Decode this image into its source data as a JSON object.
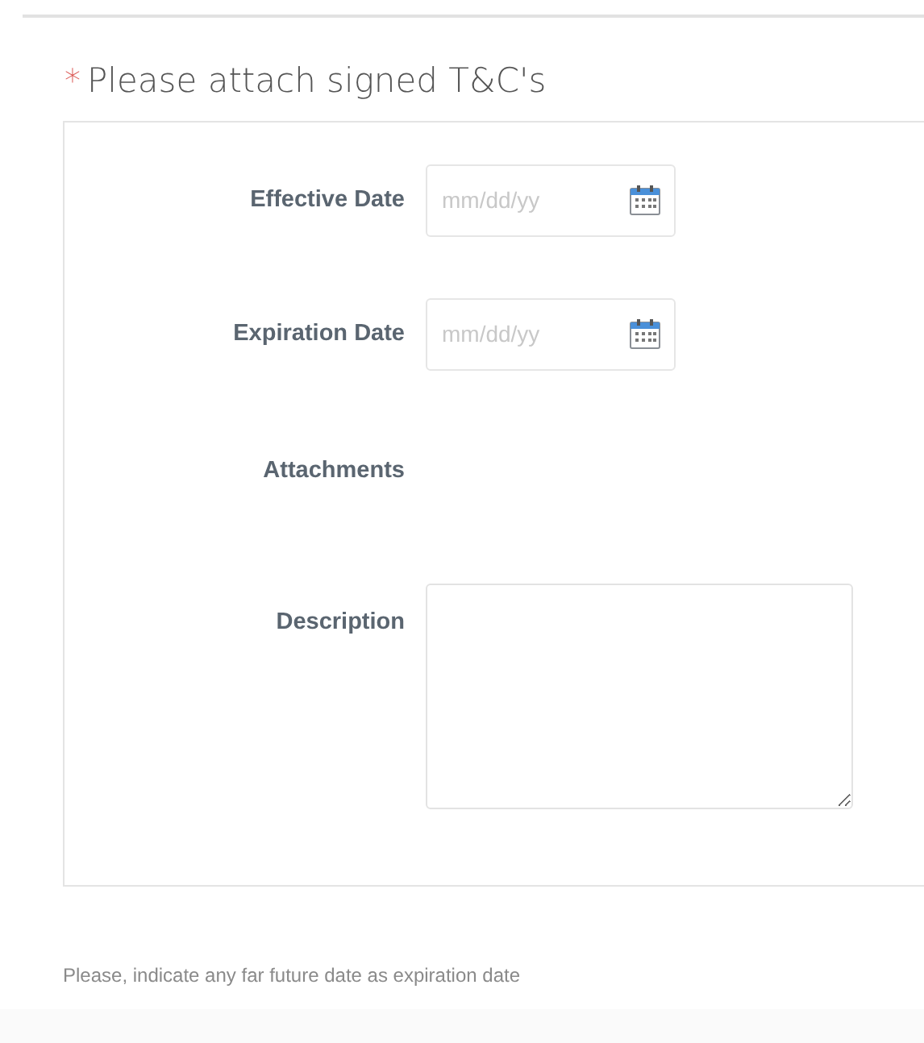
{
  "heading": {
    "required_mark": "*",
    "title": "Please attach signed T&C's"
  },
  "fields": [
    {
      "kind": "date",
      "label": "Effective Date",
      "placeholder": "mm/dd/yy"
    },
    {
      "kind": "date",
      "label": "Expiration Date",
      "placeholder": "mm/dd/yy"
    },
    {
      "kind": "attachments",
      "label": "Attachments"
    },
    {
      "kind": "textarea",
      "label": "Description"
    }
  ],
  "note": "Please, indicate any far future date as expiration date"
}
